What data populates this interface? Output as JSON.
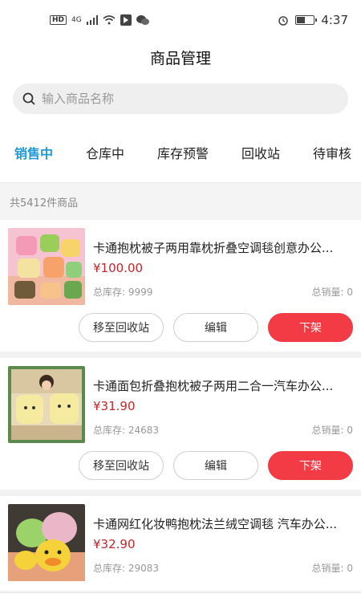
{
  "status": {
    "hd": "HD",
    "net": "4G",
    "time": "4:37",
    "icons": [
      "hd-icon",
      "signal-icon",
      "wifi-icon",
      "app-icon",
      "wechat-icon",
      "alarm-icon",
      "battery-icon"
    ]
  },
  "header": {
    "title": "商品管理"
  },
  "search": {
    "placeholder": "输入商品名称",
    "value": ""
  },
  "tabs": [
    {
      "label": "销售中",
      "active": true
    },
    {
      "label": "仓库中"
    },
    {
      "label": "库存预警"
    },
    {
      "label": "回收站"
    },
    {
      "label": "待审核"
    }
  ],
  "count_text": "共5412件商品",
  "colors": {
    "accent": "#1e9ad6",
    "price": "#c1272d",
    "offline_button": "#f23b45"
  },
  "products": [
    {
      "title": "卡通抱枕被子两用靠枕折叠空调毯创意办公...",
      "price": "¥100.00",
      "stock": "总库存: 9999",
      "sales": "总销量: 0",
      "btn_recycle": "移至回收站",
      "btn_edit": "编辑",
      "btn_offline": "下架"
    },
    {
      "title": "卡通面包折叠抱枕被子两用二合一汽车办公...",
      "price": "¥31.90",
      "stock": "总库存: 24683",
      "sales": "总销量: 0",
      "btn_recycle": "移至回收站",
      "btn_edit": "编辑",
      "btn_offline": "下架"
    },
    {
      "title": "卡通网红化妆鸭抱枕法兰绒空调毯 汽车办公...",
      "price": "¥32.90",
      "stock": "总库存: 29083",
      "sales": "总销量: 0"
    }
  ]
}
